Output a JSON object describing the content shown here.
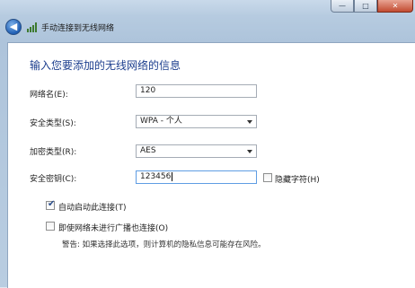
{
  "window": {
    "caption_min": "—",
    "caption_max": "□",
    "caption_close": "✕"
  },
  "titlebar": {
    "title": "手动连接到无线网络",
    "back_glyph": "◀"
  },
  "form": {
    "heading": "输入您要添加的无线网络的信息",
    "network_name_label": "网络名(E):",
    "network_name_value": "120",
    "security_type_label": "安全类型(S):",
    "security_type_value": "WPA - 个人",
    "encryption_type_label": "加密类型(R):",
    "encryption_type_value": "AES",
    "security_key_label": "安全密钥(C):",
    "security_key_value": "123456",
    "hide_chars_label": "隐藏字符(H)",
    "hide_chars_checked": false,
    "auto_start_label": "自动启动此连接(T)",
    "auto_start_checked": true,
    "connect_hidden_label": "即使网络未进行广播也连接(O)",
    "connect_hidden_checked": false,
    "warning_text": "警告: 如果选择此选项，则计算机的隐私信息可能存在风险。"
  },
  "icons": {
    "back": "back-arrow-icon",
    "network": "wireless-network-icon",
    "dropdown": "chevron-down-icon",
    "check": "checkmark-icon"
  }
}
